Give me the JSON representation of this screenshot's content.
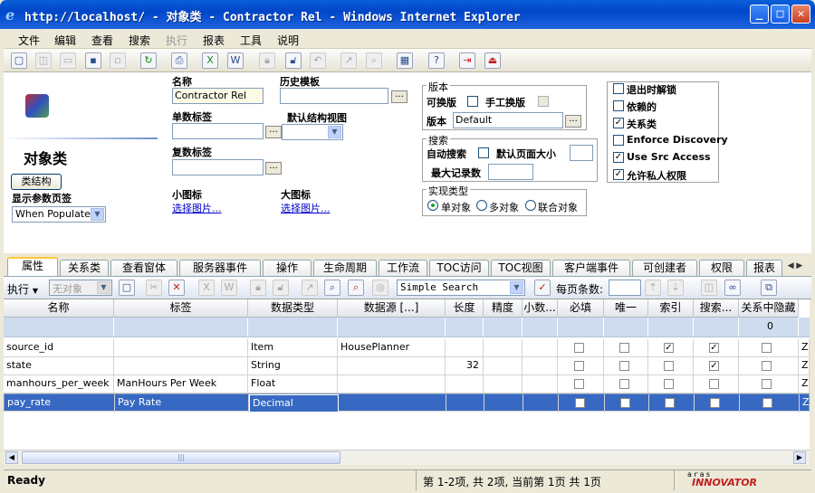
{
  "window": {
    "title": "http://localhost/ - 对象类 - Contractor Rel - Windows Internet Explorer"
  },
  "menu": [
    "文件",
    "编辑",
    "查看",
    "搜索",
    "执行",
    "报表",
    "工具",
    "说明"
  ],
  "form": {
    "heading": "对象类",
    "class_structure_button": "类结构",
    "show_params_label": "显示参数页签",
    "show_params_value": "When Populated",
    "name_label": "名称",
    "name_value": "Contractor Rel",
    "history_template_label": "历史模板",
    "singular_label_label": "单数标签",
    "default_structure_view_label": "默认结构视图",
    "plural_label_label": "复数标签",
    "small_icon_label": "小图标",
    "small_icon_link": "选择图片...",
    "large_icon_label": "大图标",
    "large_icon_link": "选择图片...",
    "version_group": "版本",
    "versionable_label": "可换版",
    "manual_version_label": "手工换版",
    "revision_label": "版本",
    "revision_value": "Default",
    "search_group": "搜索",
    "auto_search_label": "自动搜索",
    "default_page_size_label": "默认页面大小",
    "max_records_label": "最大记录数",
    "impl_group": "实现类型",
    "impl_single": "单对象",
    "impl_multi": "多对象",
    "impl_federated": "联合对象",
    "flags": [
      {
        "label": "退出时解锁",
        "checked": false
      },
      {
        "label": "依赖的",
        "checked": false
      },
      {
        "label": "关系类",
        "checked": true
      },
      {
        "label": "Enforce Discovery",
        "checked": false
      },
      {
        "label": "Use Src Access",
        "checked": true
      },
      {
        "label": "允许私人权限",
        "checked": true
      }
    ]
  },
  "tabs": [
    "属性",
    "关系类",
    "查看窗体",
    "服务器事件",
    "操作",
    "生命周期",
    "工作流",
    "TOC访问",
    "TOC视图",
    "客户端事件",
    "可创建者",
    "权限",
    "报表"
  ],
  "gridtool": {
    "execute": "执行",
    "no_object": "无对象",
    "search_mode": "Simple Search",
    "page_size_label": "每页条数:"
  },
  "grid": {
    "columns": [
      "名称",
      "标签",
      "数据类型",
      "数据源 [...]",
      "长度",
      "精度",
      "小数...",
      "必填",
      "唯一",
      "索引",
      "搜索...",
      "关系中隐藏"
    ],
    "filter_value": "0",
    "rows": [
      {
        "name": "source_id",
        "label": "",
        "type": "Item",
        "source": "HousePlanner",
        "length": "",
        "checks": [
          false,
          false,
          true,
          true,
          false
        ],
        "tail": "Z"
      },
      {
        "name": "state",
        "label": "",
        "type": "String",
        "source": "",
        "length": "32",
        "checks": [
          false,
          false,
          false,
          true,
          false
        ],
        "tail": "Z"
      },
      {
        "name": "manhours_per_week",
        "label": "ManHours Per Week",
        "type": "Float",
        "source": "",
        "length": "",
        "checks": [
          false,
          false,
          false,
          false,
          false
        ],
        "tail": "Z"
      },
      {
        "name": "pay_rate",
        "label": "Pay Rate",
        "type": "Decimal",
        "source": "",
        "length": "",
        "checks": [
          false,
          false,
          false,
          false,
          false
        ],
        "tail": "Z",
        "selected": true
      }
    ]
  },
  "status": {
    "left": "Ready",
    "middle": "第 1-2项, 共 2项, 当前第 1页 共 1页",
    "brand_top": "aras",
    "brand": "INNOVATOR"
  }
}
